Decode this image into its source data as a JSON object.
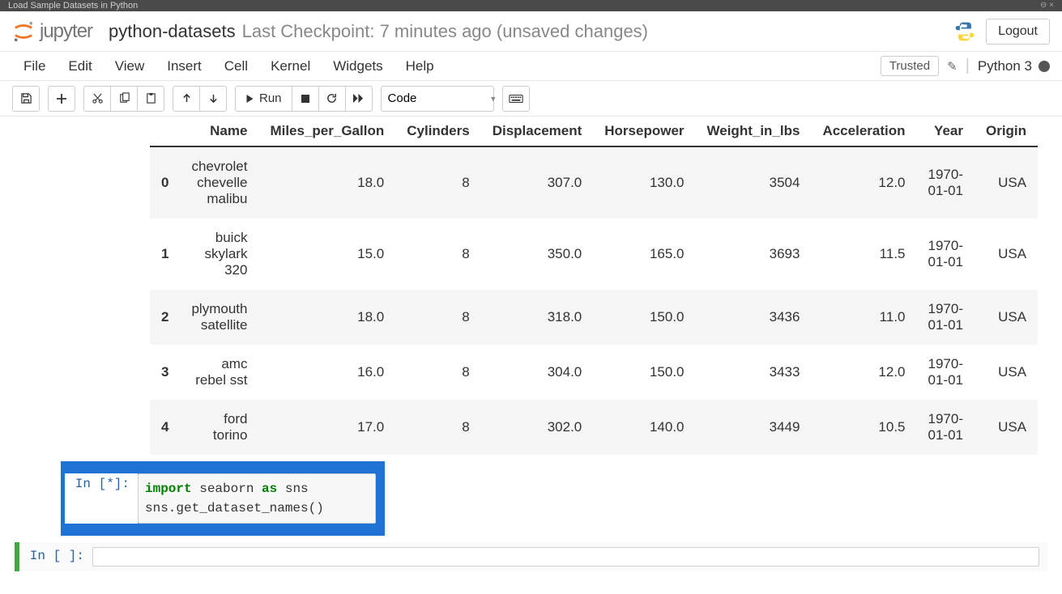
{
  "browser": {
    "tab_title": "Load Sample Datasets in Python"
  },
  "header": {
    "logo_text": "jupyter",
    "notebook_name": "python-datasets",
    "checkpoint_info": "Last Checkpoint: 7 minutes ago  (unsaved changes)",
    "logout": "Logout"
  },
  "menubar": {
    "items": [
      "File",
      "Edit",
      "View",
      "Insert",
      "Cell",
      "Kernel",
      "Widgets",
      "Help"
    ],
    "trusted": "Trusted",
    "kernel": "Python 3"
  },
  "toolbar": {
    "run_label": "Run",
    "celltype": "Code"
  },
  "table": {
    "columns": [
      "",
      "Name",
      "Miles_per_Gallon",
      "Cylinders",
      "Displacement",
      "Horsepower",
      "Weight_in_lbs",
      "Acceleration",
      "Year",
      "Origin"
    ],
    "rows": [
      {
        "idx": "0",
        "Name": "chevrolet chevelle malibu",
        "Miles_per_Gallon": "18.0",
        "Cylinders": "8",
        "Displacement": "307.0",
        "Horsepower": "130.0",
        "Weight_in_lbs": "3504",
        "Acceleration": "12.0",
        "Year": "1970-01-01",
        "Origin": "USA"
      },
      {
        "idx": "1",
        "Name": "buick skylark 320",
        "Miles_per_Gallon": "15.0",
        "Cylinders": "8",
        "Displacement": "350.0",
        "Horsepower": "165.0",
        "Weight_in_lbs": "3693",
        "Acceleration": "11.5",
        "Year": "1970-01-01",
        "Origin": "USA"
      },
      {
        "idx": "2",
        "Name": "plymouth satellite",
        "Miles_per_Gallon": "18.0",
        "Cylinders": "8",
        "Displacement": "318.0",
        "Horsepower": "150.0",
        "Weight_in_lbs": "3436",
        "Acceleration": "11.0",
        "Year": "1970-01-01",
        "Origin": "USA"
      },
      {
        "idx": "3",
        "Name": "amc rebel sst",
        "Miles_per_Gallon": "16.0",
        "Cylinders": "8",
        "Displacement": "304.0",
        "Horsepower": "150.0",
        "Weight_in_lbs": "3433",
        "Acceleration": "12.0",
        "Year": "1970-01-01",
        "Origin": "USA"
      },
      {
        "idx": "4",
        "Name": "ford torino",
        "Miles_per_Gallon": "17.0",
        "Cylinders": "8",
        "Displacement": "302.0",
        "Horsepower": "140.0",
        "Weight_in_lbs": "3449",
        "Acceleration": "10.5",
        "Year": "1970-01-01",
        "Origin": "USA"
      }
    ]
  },
  "cells": {
    "running": {
      "prompt": "In [*]:",
      "code_kw1": "import",
      "code_mod": " seaborn ",
      "code_kw2": "as",
      "code_alias": " sns",
      "code_line2": "sns.get_dataset_names()"
    },
    "empty": {
      "prompt": "In [ ]:"
    }
  }
}
